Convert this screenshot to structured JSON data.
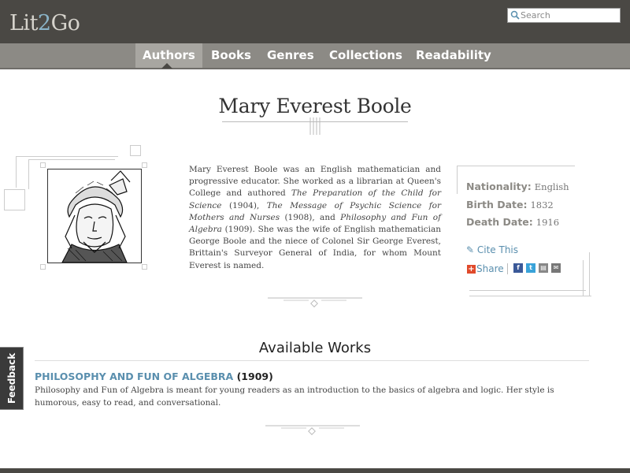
{
  "header": {
    "logo_prefix": "Lit",
    "logo_two": "2",
    "logo_suffix": "Go",
    "search_placeholder": "Search"
  },
  "nav": {
    "items": [
      "Authors",
      "Books",
      "Genres",
      "Collections",
      "Readability"
    ],
    "active": "Authors"
  },
  "author": {
    "name": "Mary Everest Boole",
    "bio_lines": [
      "Mary Everest Boole was an English mathematician and progressive educator. She worked as a librarian at Queen's College and authored ",
      "The Preparation of the Child for Science",
      " (1904), ",
      "The Message of Psychic Science for Mothers and Nurses",
      " (1908), and ",
      "Philosophy and Fun of Algebra",
      " (1909). She was the wife of English mathematician George Boole and the niece of Colonel Sir George Everest, Brittain's Surveyor General of India, for whom Mount Everest is named."
    ],
    "facts": [
      {
        "label": "Nationality:",
        "value": "English"
      },
      {
        "label": "Birth Date:",
        "value": "1832"
      },
      {
        "label": "Death Date:",
        "value": "1916"
      }
    ],
    "cite_label": "✎ Cite This",
    "share_label": "Share"
  },
  "works": {
    "heading": "Available Works",
    "items": [
      {
        "title": "PHILOSOPHY AND FUN OF ALGEBRA",
        "year": "(1909)",
        "description": "Philosophy and Fun of Algebra is meant for young readers as an introduction to the basics of algebra and logic. Her style is humorous, easy to read, and conversational."
      }
    ]
  },
  "feedback_label": "Feedback",
  "colors": {
    "header_bg": "#4a4844",
    "nav_bg": "#8c8a85",
    "link": "#5a8fae"
  }
}
